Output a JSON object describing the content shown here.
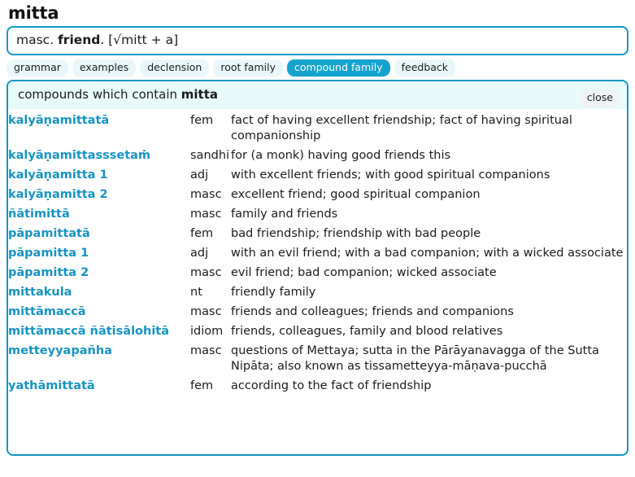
{
  "headword": "mitta",
  "definition": {
    "grammar": "masc.",
    "meaning": "friend",
    "construction": ". [√mitt + a]",
    "full": "masc. friend. [√mitt + a]"
  },
  "tabs": [
    {
      "label": "grammar",
      "active": false
    },
    {
      "label": "examples",
      "active": false
    },
    {
      "label": "declension",
      "active": false
    },
    {
      "label": "root family",
      "active": false
    },
    {
      "label": "compound family",
      "active": true
    },
    {
      "label": "feedback",
      "active": false
    }
  ],
  "panel": {
    "header_prefix": "compounds which contain ",
    "header_word": "mitta",
    "close_label": "close",
    "accent_color": "#0f96c4",
    "header_bg": "#e8fbfb",
    "link_color": "#1694c2",
    "rows": [
      {
        "word": "kalyāṇamittatā",
        "pos": "fem",
        "meaning": "fact of having excellent friendship; fact of having spiritual companionship"
      },
      {
        "word": "kalyāṇamittasssetaṁ",
        "pos": "sandhi",
        "meaning": "for (a monk) having good friends this"
      },
      {
        "word": "kalyāṇamitta 1",
        "pos": "adj",
        "meaning": "with excellent friends; with good spiritual companions"
      },
      {
        "word": "kalyāṇamitta 2",
        "pos": "masc",
        "meaning": "excellent friend; good spiritual companion"
      },
      {
        "word": "ñātimittā",
        "pos": "masc",
        "meaning": "family and friends"
      },
      {
        "word": "pāpamittatā",
        "pos": "fem",
        "meaning": "bad friendship; friendship with bad people"
      },
      {
        "word": "pāpamitta 1",
        "pos": "adj",
        "meaning": "with an evil friend; with a bad companion; with a wicked associate"
      },
      {
        "word": "pāpamitta 2",
        "pos": "masc",
        "meaning": "evil friend; bad companion; wicked associate"
      },
      {
        "word": "mittakula",
        "pos": "nt",
        "meaning": "friendly family"
      },
      {
        "word": "mittāmaccā",
        "pos": "masc",
        "meaning": "friends and colleagues; friends and companions"
      },
      {
        "word": "mittāmaccā ñātisālohitā",
        "pos": "idiom",
        "meaning": "friends, colleagues, family and blood relatives"
      },
      {
        "word": "metteyyapañha",
        "pos": "masc",
        "meaning": "questions of Mettaya; sutta in the Pārāyanavagga of the Sutta Nipāta; also known as tissametteyya-māṇava-pucchā"
      },
      {
        "word": "yathāmittatā",
        "pos": "fem",
        "meaning": "according to the fact of friendship"
      }
    ]
  }
}
